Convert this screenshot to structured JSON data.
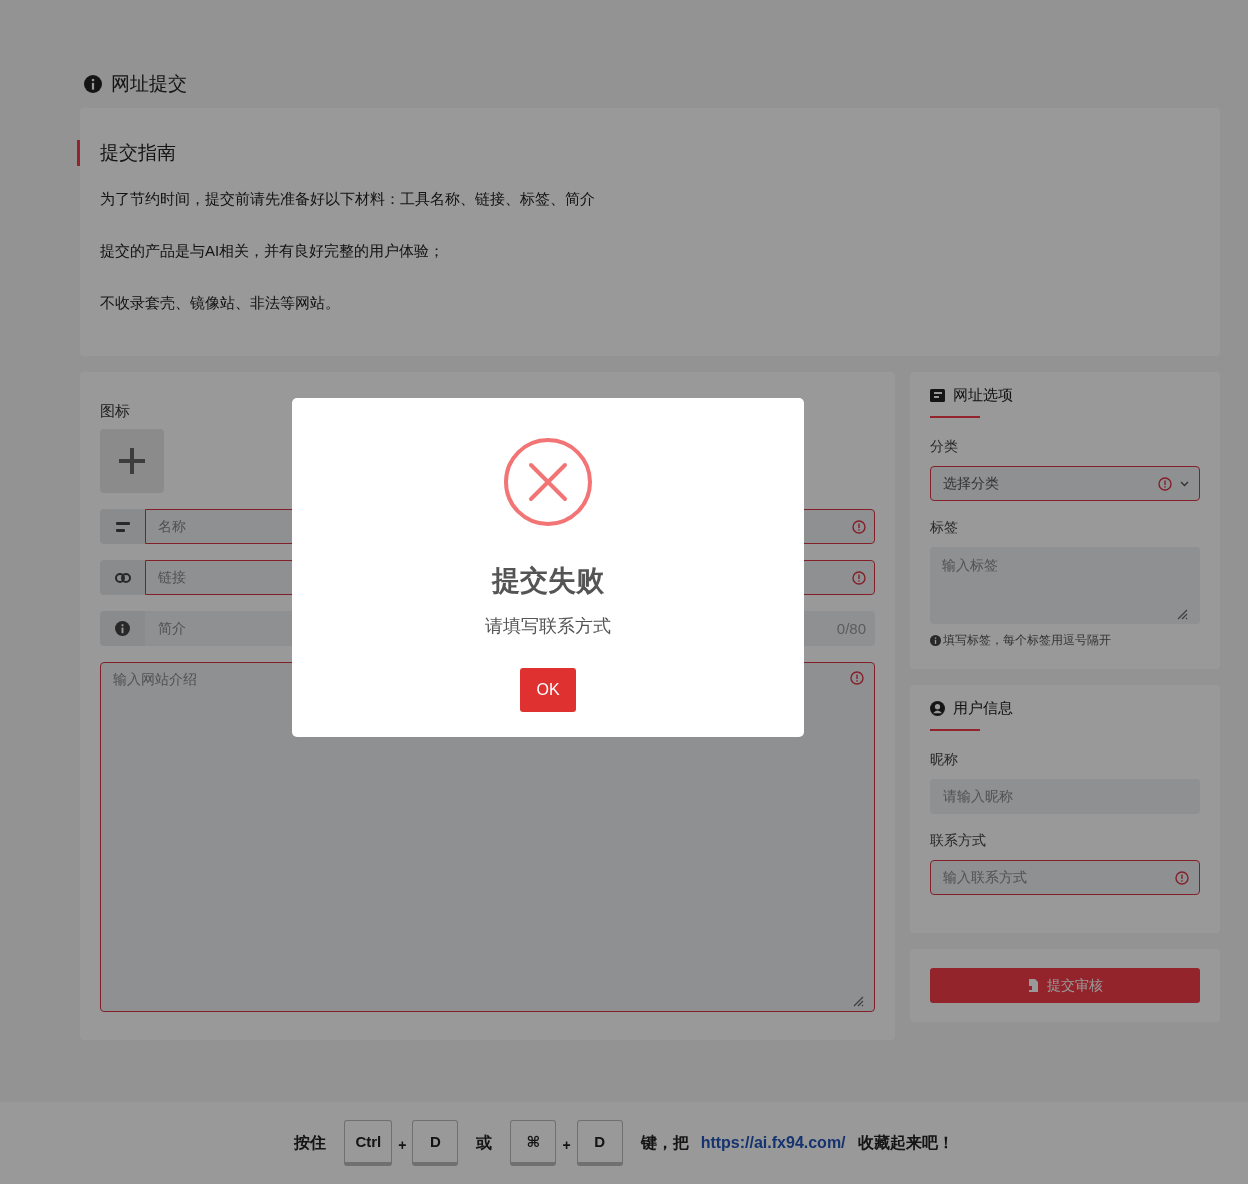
{
  "page_title": "网址提交",
  "guide": {
    "title": "提交指南",
    "paragraphs": [
      "为了节约时间，提交前请先准备好以下材料：工具名称、链接、标签、简介",
      "提交的产品是与AI相关，并有良好完整的用户体验；",
      "不收录套壳、镜像站、非法等网站。"
    ]
  },
  "form": {
    "icon_label": "图标",
    "fields": [
      {
        "placeholder": "名称",
        "invalid": true
      },
      {
        "placeholder": "链接",
        "invalid": true
      },
      {
        "placeholder": "简介",
        "invalid": false,
        "counter": "0/80"
      }
    ],
    "description": {
      "placeholder": "输入网站介绍",
      "invalid": true
    }
  },
  "options": {
    "title": "网址选项",
    "category": {
      "label": "分类",
      "value": "选择分类",
      "invalid": true
    },
    "tags": {
      "label": "标签",
      "placeholder": "输入标签",
      "hint": "填写标签，每个标签用逗号隔开"
    }
  },
  "user": {
    "title": "用户信息",
    "nickname": {
      "label": "昵称",
      "placeholder": "请输入昵称",
      "invalid": false
    },
    "contact": {
      "label": "联系方式",
      "placeholder": "输入联系方式",
      "invalid": true
    }
  },
  "submit_button": "提交审核",
  "footer": {
    "parts": [
      {
        "kind": "text",
        "text": "按住"
      },
      {
        "kind": "key",
        "text": "Ctrl"
      },
      {
        "kind": "plus",
        "text": "+"
      },
      {
        "kind": "key",
        "text": "D"
      },
      {
        "kind": "text",
        "text": "或"
      },
      {
        "kind": "key",
        "text": "⌘"
      },
      {
        "kind": "plus",
        "text": "+"
      },
      {
        "kind": "key",
        "text": "D"
      },
      {
        "kind": "text",
        "text": "键，把"
      },
      {
        "kind": "link",
        "text": "https://ai.fx94.com/"
      },
      {
        "kind": "text",
        "text": "收藏起来吧！"
      }
    ]
  },
  "dialog": {
    "title": "提交失败",
    "message": "请填写联系方式",
    "button": "OK"
  }
}
